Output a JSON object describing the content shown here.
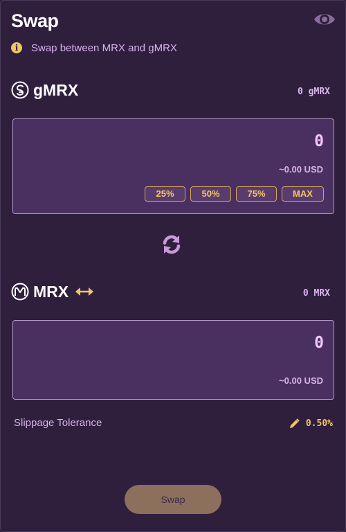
{
  "header": {
    "title": "Swap",
    "info_text": "Swap between MRX and gMRX",
    "visibility_icon": "eye-icon"
  },
  "from_token": {
    "name": "gMRX",
    "icon": "gmrx-token-icon",
    "balance": "0 gMRX",
    "amount": "0",
    "usd_value": "~0.00 USD",
    "percent_buttons": [
      "25%",
      "50%",
      "75%",
      "MAX"
    ]
  },
  "switch_icon": "refresh-icon",
  "to_token": {
    "name": "MRX",
    "icon": "mrx-token-icon",
    "swap_direction_icon": "double-arrow-icon",
    "balance": "0 MRX",
    "amount": "0",
    "usd_value": "~0.00 USD"
  },
  "slippage": {
    "label": "Slippage Tolerance",
    "value": "0.50%",
    "edit_icon": "pencil-icon"
  },
  "actions": {
    "swap_label": "Swap"
  },
  "colors": {
    "background": "#2f1f3d",
    "card": "#4a3060",
    "accent_gold": "#f0c566",
    "text_lilac": "#d7b2ea",
    "swap_button": "#8c6f5d"
  }
}
